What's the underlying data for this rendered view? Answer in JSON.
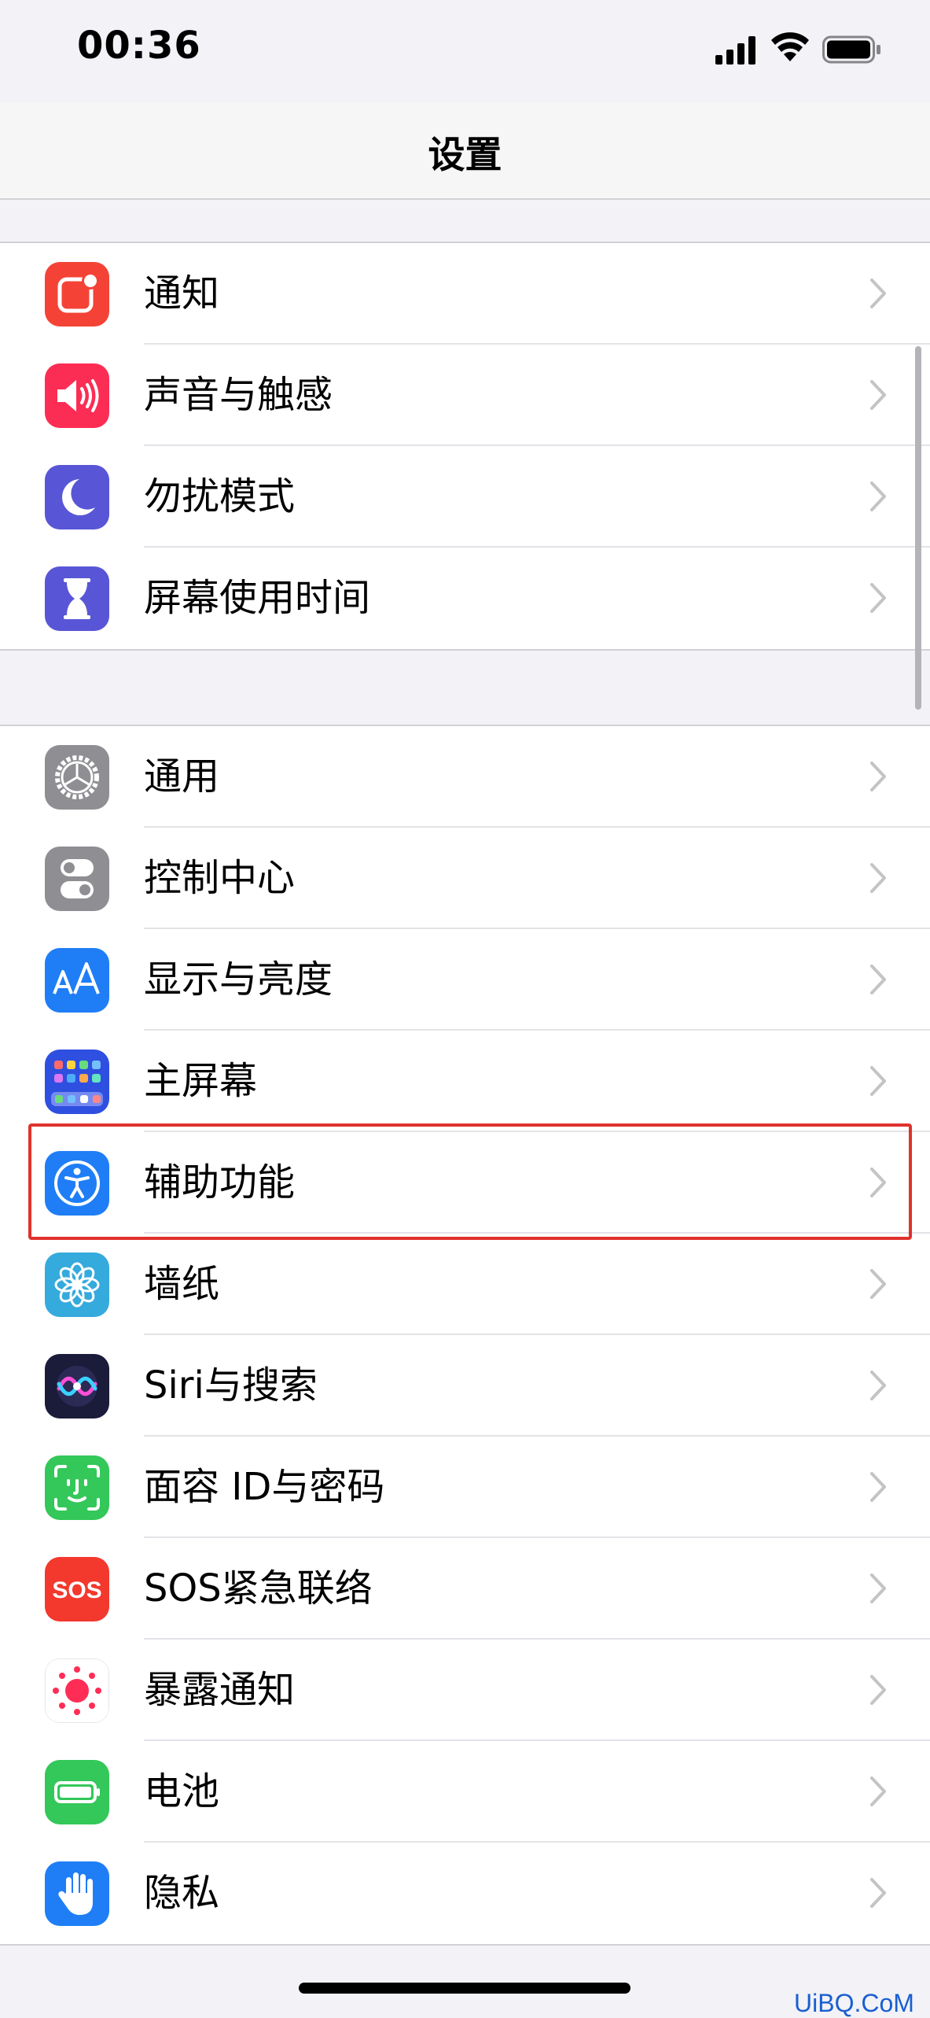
{
  "status_bar": {
    "time": "00:36"
  },
  "header": {
    "title": "设置"
  },
  "group1": [
    {
      "label": "通知",
      "icon": "notifications-icon",
      "color": "#f44336"
    },
    {
      "label": "声音与触感",
      "icon": "sound-icon",
      "color": "#fc2d55"
    },
    {
      "label": "勿扰模式",
      "icon": "moon-icon",
      "color": "#5856d6"
    },
    {
      "label": "屏幕使用时间",
      "icon": "hourglass-icon",
      "color": "#5856d6"
    }
  ],
  "group2": [
    {
      "label": "通用",
      "icon": "gear-icon",
      "color": "#8e8e93"
    },
    {
      "label": "控制中心",
      "icon": "toggles-icon",
      "color": "#8e8e93"
    },
    {
      "label": "显示与亮度",
      "icon": "text-size-icon",
      "color": "#1f7ef6"
    },
    {
      "label": "主屏幕",
      "icon": "home-screen-icon",
      "color": "#2f4fe0"
    },
    {
      "label": "辅助功能",
      "icon": "accessibility-icon",
      "color": "#1f7ef6"
    },
    {
      "label": "墙纸",
      "icon": "flower-icon",
      "color": "#35aadc"
    },
    {
      "label": "Siri与搜索",
      "icon": "siri-icon",
      "color": "#1b1b3a"
    },
    {
      "label": "面容 ID与密码",
      "icon": "face-id-icon",
      "color": "#34c759"
    },
    {
      "label": "SOS紧急联络",
      "icon": "sos-icon",
      "color": "#f3382d"
    },
    {
      "label": "暴露通知",
      "icon": "exposure-icon",
      "color": "#ffffff"
    },
    {
      "label": "电池",
      "icon": "battery-icon",
      "color": "#34c759"
    },
    {
      "label": "隐私",
      "icon": "hand-icon",
      "color": "#1f7ef6"
    }
  ],
  "highlight_color": "#e0322d",
  "watermark": "UiBQ.CoM"
}
